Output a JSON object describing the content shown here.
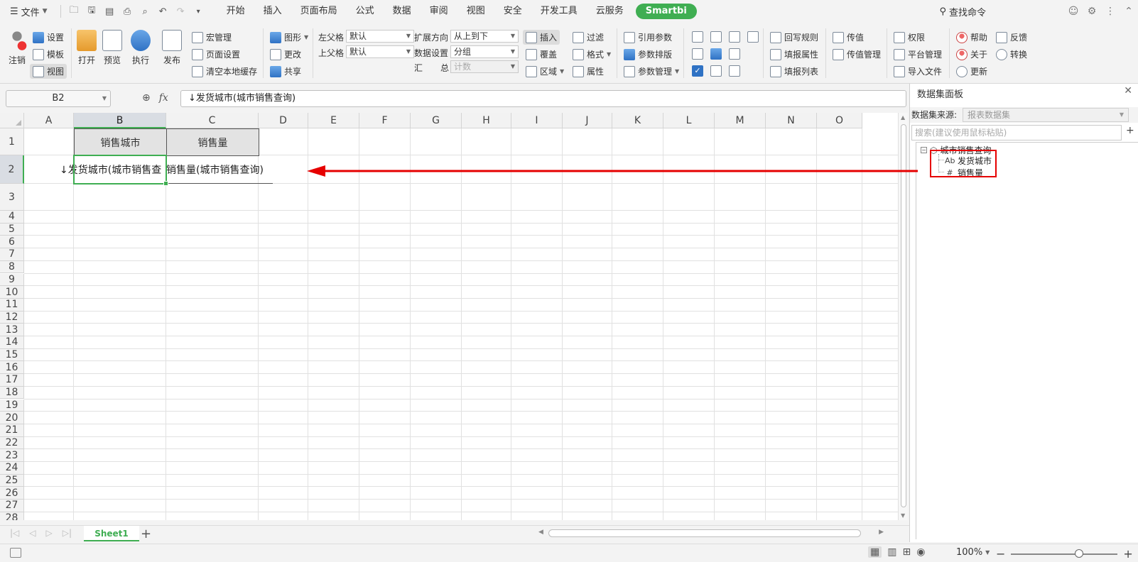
{
  "menubar": {
    "file": "文件",
    "tabs": [
      "开始",
      "插入",
      "页面布局",
      "公式",
      "数据",
      "审阅",
      "视图",
      "安全",
      "开发工具",
      "云服务",
      "Smartbi"
    ],
    "search": "查找命令"
  },
  "ribbon": {
    "logout": "注销",
    "settings": "设置",
    "template": "模板",
    "view": "视图",
    "open": "打开",
    "preview": "预览",
    "execute": "执行",
    "publish": "发布",
    "macro": "宏管理",
    "page_setup": "页面设置",
    "clear_cache": "清空本地缓存",
    "chart": "图形",
    "change": "更改",
    "share": "共享",
    "left_parent_label": "左父格",
    "left_parent_value": "默认",
    "top_parent_label": "上父格",
    "top_parent_value": "默认",
    "expand_dir_label": "扩展方向",
    "expand_dir_value": "从上到下",
    "data_setting_label": "数据设置",
    "data_setting_value": "分组",
    "summary_label_1": "汇",
    "summary_label_2": "总",
    "summary_value": "计数",
    "insert": "插入",
    "cover": "覆盖",
    "region": "区域",
    "filter": "过滤",
    "format": "格式",
    "property": "属性",
    "ref_param": "引用参数",
    "param_layout": "参数排版",
    "param_manage": "参数管理",
    "writeback_rule": "回写规则",
    "fill_property": "填报属性",
    "fill_list": "填报列表",
    "pass_value": "传值",
    "pass_manage": "传值管理",
    "permission": "权限",
    "platform_manage": "平台管理",
    "import_file": "导入文件",
    "help": "帮助",
    "feedback": "反馈",
    "about": "关于",
    "convert": "转换",
    "update": "更新"
  },
  "formula": {
    "cell_ref": "B2",
    "fx": "fx",
    "value": "↓发货城市(城市销售查询)"
  },
  "grid": {
    "columns": [
      "A",
      "B",
      "C",
      "D",
      "E",
      "F",
      "G",
      "H",
      "I",
      "J",
      "K",
      "L",
      "M",
      "N",
      "O"
    ],
    "rows": [
      "1",
      "2",
      "3",
      "4",
      "5",
      "6",
      "7",
      "8",
      "9",
      "10",
      "11",
      "12",
      "13",
      "14",
      "15",
      "16",
      "17",
      "18",
      "19",
      "20",
      "21",
      "22",
      "23",
      "24",
      "25",
      "26",
      "27",
      "28"
    ],
    "header_b1": "销售城市",
    "header_c1": "销售量",
    "cell_b2": "↓发货城市(城市销售查",
    "cell_c2": "销售量(城市销售查询)"
  },
  "sheetbar": {
    "sheet_name": "Sheet1",
    "add": "+"
  },
  "statusbar": {
    "zoom": "100%"
  },
  "panel": {
    "title": "数据集面板",
    "source_label": "数据集来源:",
    "source_value": "报表数据集",
    "search_placeholder": "搜索(建议使用鼠标粘贴)",
    "dataset": "城市销售查询",
    "fields": [
      {
        "icon": "Ab",
        "name": "发货城市"
      },
      {
        "icon": "#",
        "name": "销售量"
      }
    ]
  },
  "colors": {
    "accent": "#3fae52",
    "annotation": "#e60000"
  }
}
